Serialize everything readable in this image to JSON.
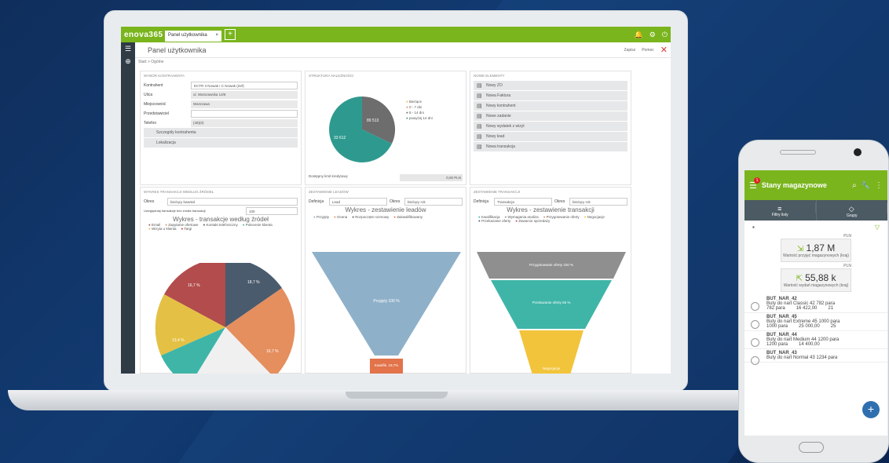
{
  "app": {
    "logo": "enova365",
    "tab_label": "Panel użytkownika",
    "page_title": "Panel użytkownika",
    "breadcrumb": "Start > Ogólne",
    "action1": "Zapisz",
    "action2": "Pomoc"
  },
  "contractor": {
    "title": "Wybór kontrahenta",
    "rows": [
      {
        "label": "Kontrahent",
        "value": "ECTR 3 Nowak I C Nowak (Zef)"
      },
      {
        "label": "Ulica",
        "value": "ul. Warszawska 14/8"
      },
      {
        "label": "Miejscowość",
        "value": "Warszawa"
      },
      {
        "label": "Przedstawiciel",
        "value": ""
      },
      {
        "label": "Telefon",
        "value": "(48)(0)"
      }
    ],
    "buttons": [
      "Szczegóły kontrahenta",
      "Lokalizacja"
    ]
  },
  "debt": {
    "title": "Struktura należności",
    "legend": [
      "Bieżące",
      "0 - 7 dni",
      "8 - 14 dni",
      "powyżej 14 dni"
    ],
    "slice_a": "89 513",
    "slice_b": "33 612",
    "footer_label": "Dostępny limit kredytowy",
    "footer_value": "0,00 PLN"
  },
  "new_elements": {
    "title": "Nowe elementy",
    "items": [
      "Nowy ZO",
      "Nowa Faktura",
      "Nowy kontrahent",
      "Nowe zadanie",
      "Nowy wydatek z wizyt",
      "Nowy lead",
      "Nowa transakcja"
    ]
  },
  "sources": {
    "title": "Wykres transakcji według źródeł",
    "period_label": "Okres",
    "period_value": "bieżący kwartał",
    "check_label": "Uwzględniaj transakcje bez źródła transakcji",
    "check_value": "100",
    "chart_title": "Wykres - transakcje według źródeł",
    "legend": [
      "Email",
      "Zapytanie ofertowe",
      "Kontakt telefoniczny",
      "Polecenie klienta",
      "Wizyta u klienta",
      "Targi"
    ],
    "labels": [
      "18,7 %",
      "16,7 %",
      "13,4 %",
      "16,7 %",
      "21,6 %"
    ]
  },
  "leads": {
    "title": "Zestawienie leadów",
    "period_label": "Definicja",
    "period_value": "Lead",
    "period2_label": "Okres",
    "period2_value": "bieżący rok",
    "chart_title": "Wykres - zestawienie leadów",
    "legend": [
      "Przyjęty",
      "Ocena",
      "Rozpoczęte rozmowy",
      "Zakwalifikowany"
    ],
    "top_label": "Przyjęty 100 %",
    "bottom_label": "Kwalifik. 18,7%"
  },
  "transactions": {
    "title": "Zestawienie transakcji",
    "period_label": "Definicja",
    "period_value": "Transakcja",
    "period2_label": "Okres",
    "period2_value": "bieżący rok",
    "chart_title": "Wykres - zestawienie transakcji",
    "legend": [
      "Kwalifikacja",
      "Wymagania analiza",
      "Przygotowanie oferty",
      "Negocjacje",
      "Przekazanie oferty",
      "Zawarcie sprzedaży"
    ],
    "l1": "Przygotowanie oferty 100 %",
    "l2": "Przekazanie oferty 55 %",
    "l3": "Negocjacje"
  },
  "phone": {
    "title": "Stany magazynowe",
    "badge": "1",
    "tool1": "Filtry listy",
    "tool2": "Grupy",
    "currency": "PLN",
    "card1_value": "1,87 M",
    "card1_label": "Wartość przyjęć magazynowych (kraj)",
    "card2_value": "55,88 k",
    "card2_label": "Wartość wydań magazynowych (kraj)",
    "items": [
      {
        "code": "BUT_NAR_42",
        "name": "Buty do nart Classic 42",
        "qty": "782 para",
        "qty2": "782 para",
        "value": "16 422,00",
        "num": "21"
      },
      {
        "code": "BUT_NAR_45",
        "name": "Buty do nart Extreme 45",
        "qty": "1000 para",
        "qty2": "1000 para",
        "value": "25 000,00",
        "num": "25"
      },
      {
        "code": "BUT_NAR_44",
        "name": "Buty do nart Medium 44",
        "qty": "1200 para",
        "qty2": "1200 para",
        "value": "14 400,00",
        "num": ""
      },
      {
        "code": "BUT_NAR_43",
        "name": "Buty do nart Normal 43",
        "qty": "1234 para",
        "qty2": "",
        "value": "",
        "num": ""
      }
    ]
  },
  "colors": {
    "green": "#7ab51d",
    "teal": "#2e9a8f",
    "gray": "#6d6d6d"
  }
}
